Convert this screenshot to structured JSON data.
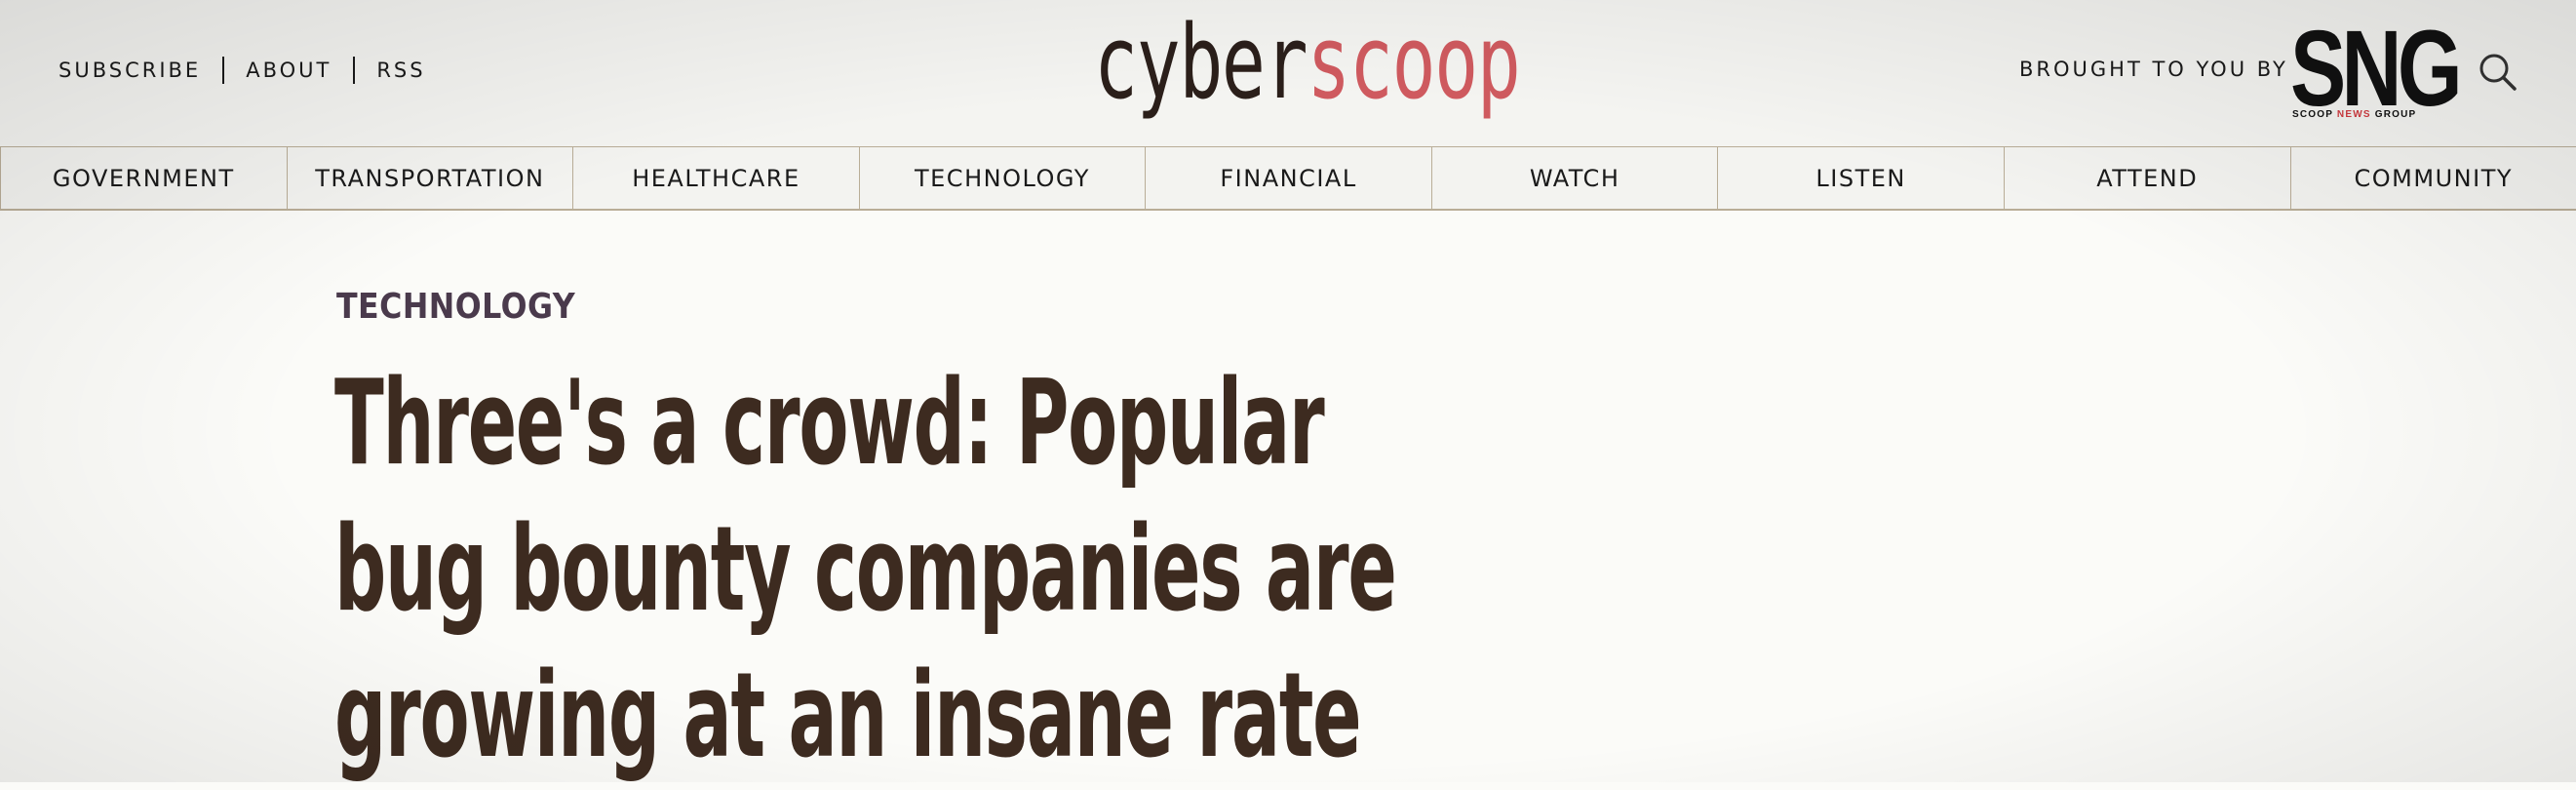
{
  "header": {
    "utility_links": [
      "SUBSCRIBE",
      "ABOUT",
      "RSS"
    ],
    "logo": {
      "part1": "cyber",
      "part2": "scoop"
    },
    "sponsor_label": "BROUGHT TO YOU BY",
    "sponsor_logo": {
      "mark": "SNG",
      "sub_part1": "SCOOP",
      "sub_part2": "NEWS",
      "sub_part3": "GROUP"
    },
    "search_icon": "search-icon"
  },
  "nav": {
    "items": [
      "GOVERNMENT",
      "TRANSPORTATION",
      "HEALTHCARE",
      "TECHNOLOGY",
      "FINANCIAL",
      "WATCH",
      "LISTEN",
      "ATTEND",
      "COMMUNITY"
    ]
  },
  "article": {
    "category": "TECHNOLOGY",
    "headline": "Three's a crowd: Popular bug bounty companies are growing at an insane rate"
  },
  "colors": {
    "text_dark": "#3d2b20",
    "logo_accent": "#cf5a5f",
    "category": "#4a3a4c",
    "nav_border": "#b9ad97"
  }
}
